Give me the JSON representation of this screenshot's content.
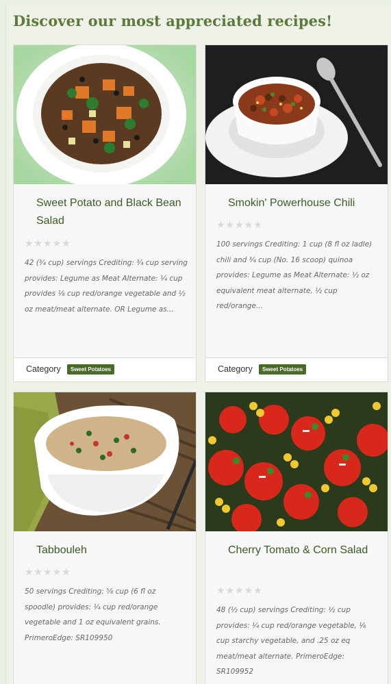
{
  "heading": "Discover our most appreciated recipes!",
  "category_label": "Category",
  "stars": "★★★★★",
  "recipes": [
    {
      "title": "Sweet Potato and Black Bean Salad",
      "desc": "42 (¾ cup) servings Crediting: ¾ cup serving provides: Legume as Meat Alternate: ¼ cup provides ⅛ cup red/orange vegetable and ½ oz meat/meat alternate. OR Legume as...",
      "category": "Sweet Potatoes"
    },
    {
      "title": "Smokin' Powerhouse Chili",
      "desc": "100 servings Crediting: 1 cup (8 fl oz ladle) chili and ¾ cup (No. 16 scoop) quinoa provides: Legume as Meat Alternate: ½ oz equivalent meat alternate, ½ cup red/orange...",
      "category": "Sweet Potatoes"
    },
    {
      "title": "Tabbouleh",
      "desc": "50 servings Crediting: ⅝ cup (6 fl oz spoodle) provides: ¼ cup red/orange vegetable and 1 oz equivalent grains. PrimeroEdge: SR109950"
    },
    {
      "title": "Cherry Tomato & Corn Salad",
      "desc": "48 (½ cup) servings Crediting: ½ cup provides: ¼ cup red/orange vegetable, ⅛ cup starchy vegetable, and .25 oz eq meat/meat alternate. PrimeroEdge: SR109952"
    }
  ]
}
